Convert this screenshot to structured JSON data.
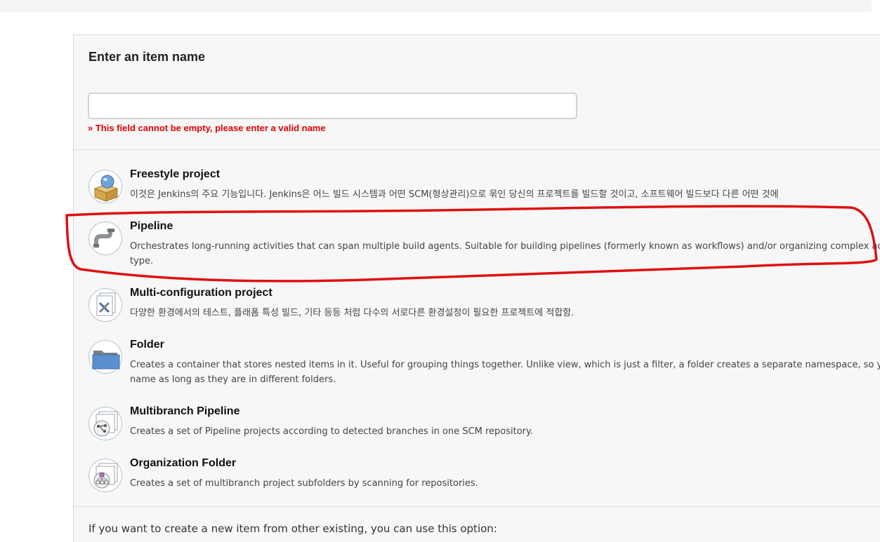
{
  "form": {
    "heading": "Enter an item name",
    "name_value": "",
    "name_placeholder": "",
    "error_message": "» This field cannot be empty, please enter a valid name"
  },
  "items": [
    {
      "title": "Freestyle project",
      "description": "이것은 Jenkins의 주요 기능입니다. Jenkins은 어느 빌드 시스템과 어떤 SCM(형상관리)으로 묶인 당신의 프로젝트를 빌드할 것이고, 소프트웨어 빌드보다 다른 어떤 것에",
      "icon": "freestyle-icon"
    },
    {
      "title": "Pipeline",
      "description": "Orchestrates long-running activities that can span multiple build agents. Suitable for building pipelines (formerly known as workflows) and/or organizing complex act\ntype.",
      "icon": "pipeline-icon"
    },
    {
      "title": "Multi-configuration project",
      "description": "다양한 환경에서의 테스트, 플래폼 특성 빌드, 기타 등등 처럼 다수의 서로다른 환경설정이 필요한 프로젝트에 적합함.",
      "icon": "multi-configuration-icon"
    },
    {
      "title": "Folder",
      "description": "Creates a container that stores nested items in it. Useful for grouping things together. Unlike view, which is just a filter, a folder creates a separate namespace, so you\nname as long as they are in different folders.",
      "icon": "folder-icon"
    },
    {
      "title": "Multibranch Pipeline",
      "description": "Creates a set of Pipeline projects according to detected branches in one SCM repository.",
      "icon": "multibranch-pipeline-icon"
    },
    {
      "title": "Organization Folder",
      "description": "Creates a set of multibranch project subfolders by scanning for repositories.",
      "icon": "organization-folder-icon"
    }
  ],
  "copy_section": {
    "text": "If you want to create a new item from other existing, you can use this option:"
  },
  "colors": {
    "error": "#e00000",
    "annotation": "#e01010",
    "panel_bg": "#f7f7f8"
  }
}
